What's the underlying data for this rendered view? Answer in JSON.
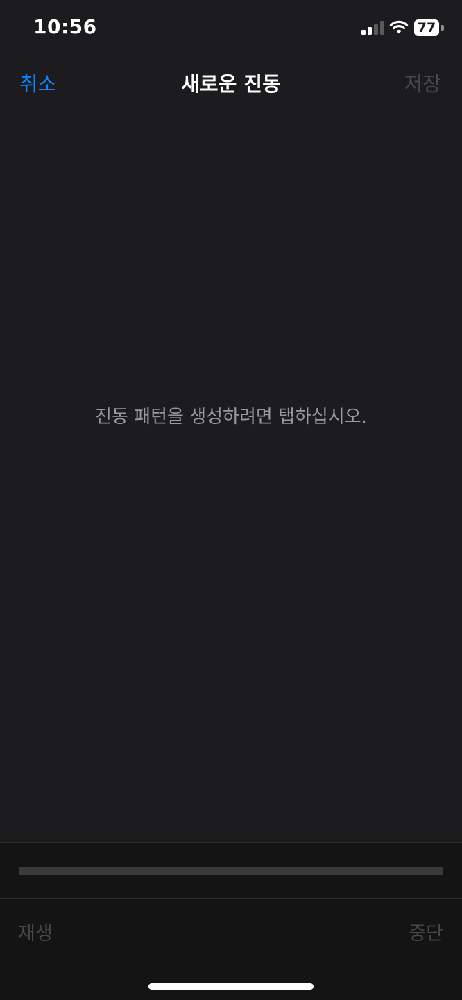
{
  "status_bar": {
    "time": "10:56",
    "battery_level": "77",
    "signal_bars_active": 2,
    "signal_bars_total": 4,
    "icons": [
      "cellular-signal-icon",
      "wifi-icon",
      "battery-icon"
    ]
  },
  "nav": {
    "cancel_label": "취소",
    "title": "새로운 진동",
    "save_label": "저장"
  },
  "tap_area": {
    "instruction": "진동 패턴을 생성하려면 탭하십시오."
  },
  "playback": {
    "progress": 0,
    "play_label": "재생",
    "stop_label": "중단"
  },
  "colors": {
    "accent": "#0a84ff",
    "background": "#1c1c1e",
    "panel": "#141414",
    "disabled_text": "#48484a",
    "secondary_text": "#98989d"
  }
}
